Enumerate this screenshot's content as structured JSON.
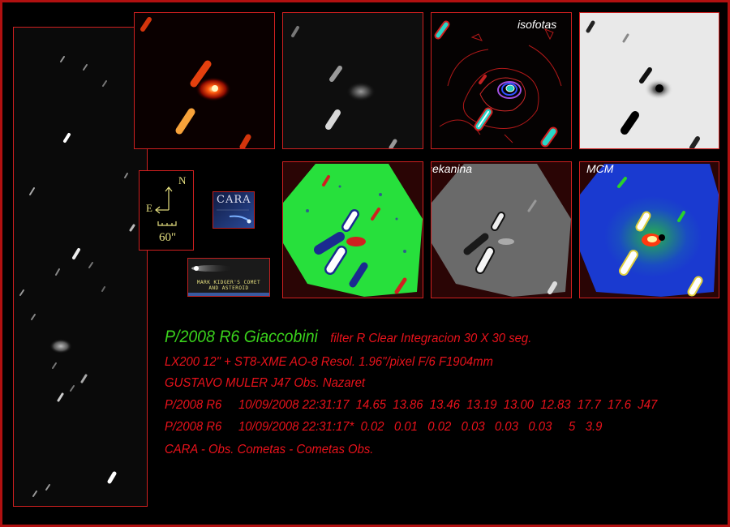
{
  "labels": {
    "isofotas": "isofotas",
    "larson": "larson sekanina",
    "mcm": "MCM"
  },
  "orientation": {
    "north": "N",
    "east": "E",
    "scale": "60\""
  },
  "logo": {
    "cara": "CARA"
  },
  "ad": {
    "line1": "MARK KIDGER'S COMET",
    "line2": "AND ASTEROID"
  },
  "info": {
    "object": "P/2008 R6 Giaccobini",
    "line1_rest": "filter R Clear   Integracion 30 X 30 seg.",
    "line2": "LX200 12\" +  ST8-XME AO-8   Resol. 1.96\"/pixel  F/6  F1904mm",
    "line3": "GUSTAVO MULER  J47 Obs. Nazaret",
    "line4": "P/2008 R6     10/09/2008 22:31:17  14.65  13.86  13.46  13.19  13.00  12.83  17.7  17.6  J47",
    "line5": "P/2008 R6     10/09/2008 22:31:17*  0.02   0.01   0.02   0.03   0.03   0.03     5   3.9",
    "line6": "CARA -  Obs. Cometas  -  Cometas Obs."
  },
  "colors": {
    "border": "#b01010",
    "text_red": "#e8121b",
    "text_green": "#3ad21c"
  }
}
